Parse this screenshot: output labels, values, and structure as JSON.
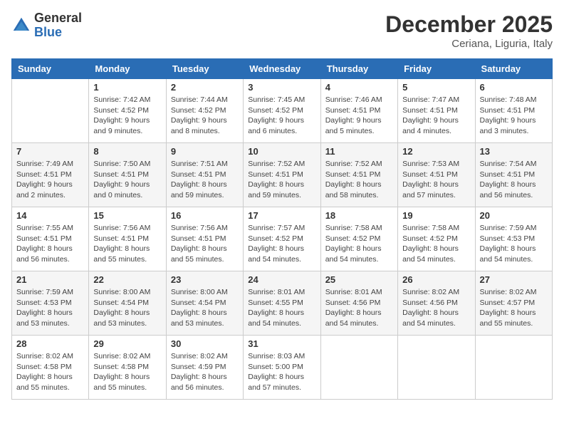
{
  "logo": {
    "general": "General",
    "blue": "Blue"
  },
  "title": "December 2025",
  "location": "Ceriana, Liguria, Italy",
  "days_of_week": [
    "Sunday",
    "Monday",
    "Tuesday",
    "Wednesday",
    "Thursday",
    "Friday",
    "Saturday"
  ],
  "weeks": [
    [
      {
        "num": "",
        "info": ""
      },
      {
        "num": "1",
        "info": "Sunrise: 7:42 AM\nSunset: 4:52 PM\nDaylight: 9 hours\nand 9 minutes."
      },
      {
        "num": "2",
        "info": "Sunrise: 7:44 AM\nSunset: 4:52 PM\nDaylight: 9 hours\nand 8 minutes."
      },
      {
        "num": "3",
        "info": "Sunrise: 7:45 AM\nSunset: 4:52 PM\nDaylight: 9 hours\nand 6 minutes."
      },
      {
        "num": "4",
        "info": "Sunrise: 7:46 AM\nSunset: 4:51 PM\nDaylight: 9 hours\nand 5 minutes."
      },
      {
        "num": "5",
        "info": "Sunrise: 7:47 AM\nSunset: 4:51 PM\nDaylight: 9 hours\nand 4 minutes."
      },
      {
        "num": "6",
        "info": "Sunrise: 7:48 AM\nSunset: 4:51 PM\nDaylight: 9 hours\nand 3 minutes."
      }
    ],
    [
      {
        "num": "7",
        "info": "Sunrise: 7:49 AM\nSunset: 4:51 PM\nDaylight: 9 hours\nand 2 minutes."
      },
      {
        "num": "8",
        "info": "Sunrise: 7:50 AM\nSunset: 4:51 PM\nDaylight: 9 hours\nand 0 minutes."
      },
      {
        "num": "9",
        "info": "Sunrise: 7:51 AM\nSunset: 4:51 PM\nDaylight: 8 hours\nand 59 minutes."
      },
      {
        "num": "10",
        "info": "Sunrise: 7:52 AM\nSunset: 4:51 PM\nDaylight: 8 hours\nand 59 minutes."
      },
      {
        "num": "11",
        "info": "Sunrise: 7:52 AM\nSunset: 4:51 PM\nDaylight: 8 hours\nand 58 minutes."
      },
      {
        "num": "12",
        "info": "Sunrise: 7:53 AM\nSunset: 4:51 PM\nDaylight: 8 hours\nand 57 minutes."
      },
      {
        "num": "13",
        "info": "Sunrise: 7:54 AM\nSunset: 4:51 PM\nDaylight: 8 hours\nand 56 minutes."
      }
    ],
    [
      {
        "num": "14",
        "info": "Sunrise: 7:55 AM\nSunset: 4:51 PM\nDaylight: 8 hours\nand 56 minutes."
      },
      {
        "num": "15",
        "info": "Sunrise: 7:56 AM\nSunset: 4:51 PM\nDaylight: 8 hours\nand 55 minutes."
      },
      {
        "num": "16",
        "info": "Sunrise: 7:56 AM\nSunset: 4:51 PM\nDaylight: 8 hours\nand 55 minutes."
      },
      {
        "num": "17",
        "info": "Sunrise: 7:57 AM\nSunset: 4:52 PM\nDaylight: 8 hours\nand 54 minutes."
      },
      {
        "num": "18",
        "info": "Sunrise: 7:58 AM\nSunset: 4:52 PM\nDaylight: 8 hours\nand 54 minutes."
      },
      {
        "num": "19",
        "info": "Sunrise: 7:58 AM\nSunset: 4:52 PM\nDaylight: 8 hours\nand 54 minutes."
      },
      {
        "num": "20",
        "info": "Sunrise: 7:59 AM\nSunset: 4:53 PM\nDaylight: 8 hours\nand 54 minutes."
      }
    ],
    [
      {
        "num": "21",
        "info": "Sunrise: 7:59 AM\nSunset: 4:53 PM\nDaylight: 8 hours\nand 53 minutes."
      },
      {
        "num": "22",
        "info": "Sunrise: 8:00 AM\nSunset: 4:54 PM\nDaylight: 8 hours\nand 53 minutes."
      },
      {
        "num": "23",
        "info": "Sunrise: 8:00 AM\nSunset: 4:54 PM\nDaylight: 8 hours\nand 53 minutes."
      },
      {
        "num": "24",
        "info": "Sunrise: 8:01 AM\nSunset: 4:55 PM\nDaylight: 8 hours\nand 54 minutes."
      },
      {
        "num": "25",
        "info": "Sunrise: 8:01 AM\nSunset: 4:56 PM\nDaylight: 8 hours\nand 54 minutes."
      },
      {
        "num": "26",
        "info": "Sunrise: 8:02 AM\nSunset: 4:56 PM\nDaylight: 8 hours\nand 54 minutes."
      },
      {
        "num": "27",
        "info": "Sunrise: 8:02 AM\nSunset: 4:57 PM\nDaylight: 8 hours\nand 55 minutes."
      }
    ],
    [
      {
        "num": "28",
        "info": "Sunrise: 8:02 AM\nSunset: 4:58 PM\nDaylight: 8 hours\nand 55 minutes."
      },
      {
        "num": "29",
        "info": "Sunrise: 8:02 AM\nSunset: 4:58 PM\nDaylight: 8 hours\nand 55 minutes."
      },
      {
        "num": "30",
        "info": "Sunrise: 8:02 AM\nSunset: 4:59 PM\nDaylight: 8 hours\nand 56 minutes."
      },
      {
        "num": "31",
        "info": "Sunrise: 8:03 AM\nSunset: 5:00 PM\nDaylight: 8 hours\nand 57 minutes."
      },
      {
        "num": "",
        "info": ""
      },
      {
        "num": "",
        "info": ""
      },
      {
        "num": "",
        "info": ""
      }
    ]
  ]
}
